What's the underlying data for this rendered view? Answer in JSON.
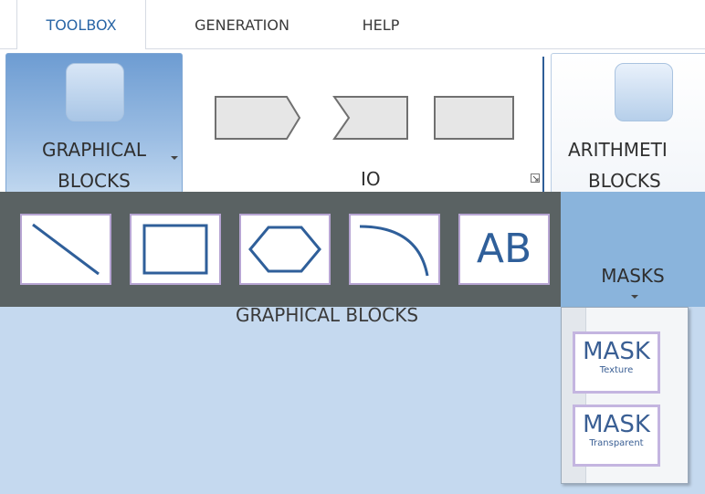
{
  "tabs": [
    {
      "label": "TOOLBOX",
      "active": true
    },
    {
      "label": "GENERATION",
      "active": false
    },
    {
      "label": "HELP",
      "active": false
    }
  ],
  "ribbon": {
    "graphical_blocks": {
      "line1": "GRAPHICAL",
      "line2": "BLOCKS"
    },
    "io": {
      "label": "IO",
      "shapes": [
        "io-input-shape-icon",
        "io-output-shape-icon",
        "io-process-shape-icon"
      ]
    },
    "arithmetic_blocks": {
      "line1": "ARITHMETI",
      "line2": "BLOCKS"
    }
  },
  "graphical_gallery": {
    "items": [
      "line-shape-icon",
      "rectangle-shape-icon",
      "hexagon-shape-icon",
      "arc-shape-icon",
      "text-shape-icon"
    ],
    "text_tile": "AB",
    "caption": "GRAPHICAL BLOCKS"
  },
  "masks": {
    "label": "MASKS",
    "items": [
      {
        "title": "MASK",
        "subtitle": "Texture"
      },
      {
        "title": "MASK",
        "subtitle": "Transparent"
      }
    ]
  },
  "colors": {
    "accent": "#2a66a6",
    "gallery_bg": "#5a6263",
    "body_bg": "#c5d9ef",
    "tile_border": "#b7a5d3"
  }
}
